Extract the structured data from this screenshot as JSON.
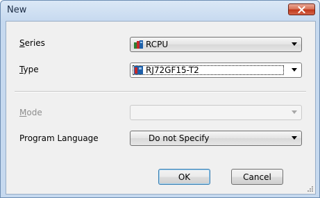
{
  "window": {
    "title": "New"
  },
  "form": {
    "series": {
      "label_accel": "S",
      "label_rest": "eries",
      "value": "RCPU"
    },
    "type": {
      "label_accel": "T",
      "label_rest": "ype",
      "value": "RJ72GF15-T2"
    },
    "mode": {
      "label_accel": "M",
      "label_rest": "ode",
      "value": ""
    },
    "program_language": {
      "label": "Program Language",
      "value": "Do not Specify"
    }
  },
  "buttons": {
    "ok": "OK",
    "cancel": "Cancel"
  },
  "icons": {
    "close": "close-x-icon",
    "series": "plc-module-icon",
    "type": "plc-module-icon",
    "dropdown": "chevron-down-icon",
    "resize": "resize-grip-icon"
  },
  "colors": {
    "close_button": "#c1391c",
    "titlebar": "#c6d9ef",
    "client": "#f0f0f0"
  }
}
